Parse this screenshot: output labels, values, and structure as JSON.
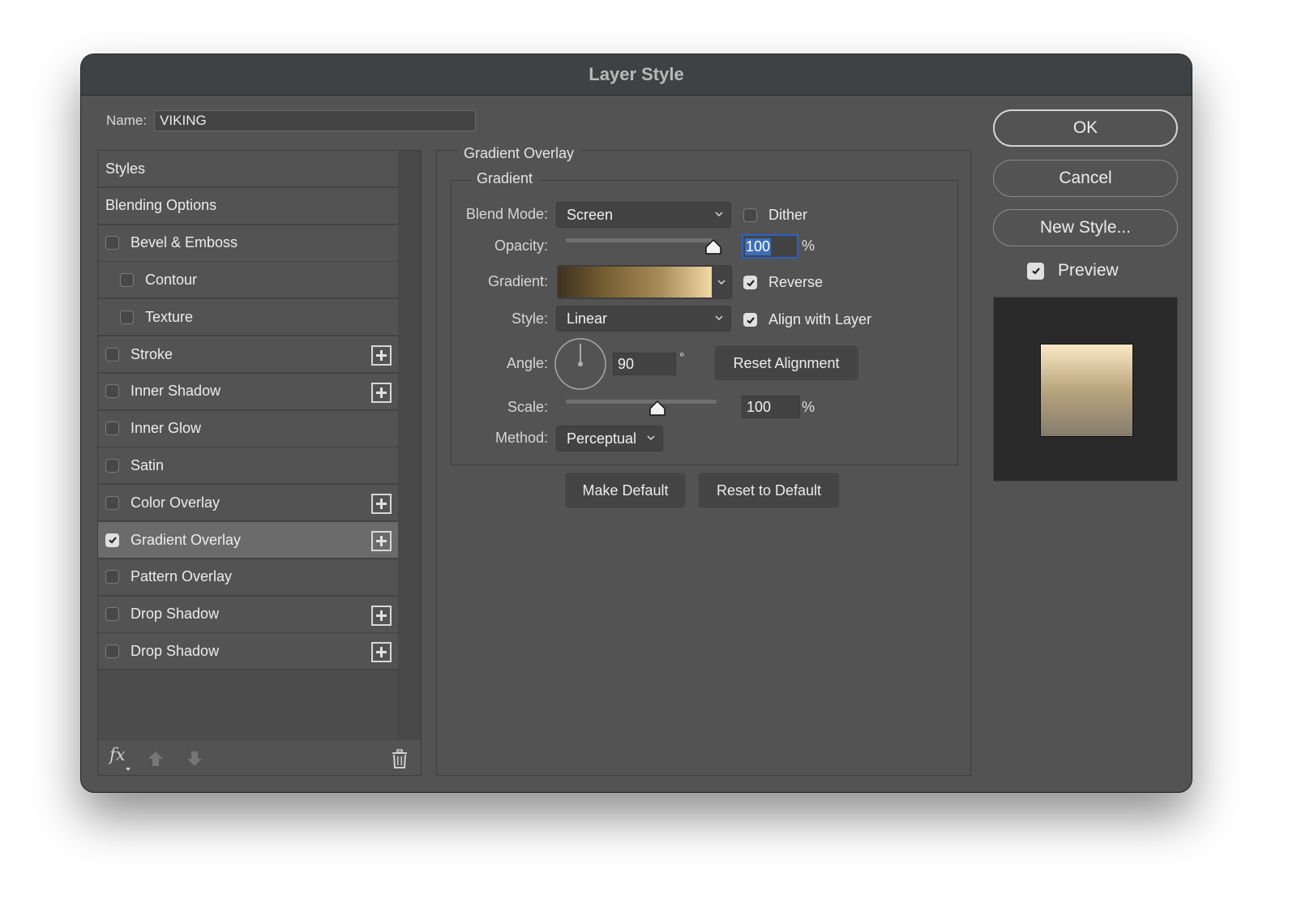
{
  "window": {
    "title": "Layer Style"
  },
  "name_field": {
    "label": "Name:",
    "value": "VIKING"
  },
  "style_list": {
    "items": [
      {
        "label": "Styles",
        "has_checkbox": false,
        "checked": false,
        "indent": false,
        "has_add": false,
        "selected": false
      },
      {
        "label": "Blending Options",
        "has_checkbox": false,
        "checked": false,
        "indent": false,
        "has_add": false,
        "selected": false
      },
      {
        "label": "Bevel & Emboss",
        "has_checkbox": true,
        "checked": false,
        "indent": false,
        "has_add": false,
        "selected": false
      },
      {
        "label": "Contour",
        "has_checkbox": true,
        "checked": false,
        "indent": true,
        "has_add": false,
        "selected": false
      },
      {
        "label": "Texture",
        "has_checkbox": true,
        "checked": false,
        "indent": true,
        "has_add": false,
        "selected": false
      },
      {
        "label": "Stroke",
        "has_checkbox": true,
        "checked": false,
        "indent": false,
        "has_add": true,
        "selected": false
      },
      {
        "label": "Inner Shadow",
        "has_checkbox": true,
        "checked": false,
        "indent": false,
        "has_add": true,
        "selected": false
      },
      {
        "label": "Inner Glow",
        "has_checkbox": true,
        "checked": false,
        "indent": false,
        "has_add": false,
        "selected": false
      },
      {
        "label": "Satin",
        "has_checkbox": true,
        "checked": false,
        "indent": false,
        "has_add": false,
        "selected": false
      },
      {
        "label": "Color Overlay",
        "has_checkbox": true,
        "checked": false,
        "indent": false,
        "has_add": true,
        "selected": false
      },
      {
        "label": "Gradient Overlay",
        "has_checkbox": true,
        "checked": true,
        "indent": false,
        "has_add": true,
        "selected": true
      },
      {
        "label": "Pattern Overlay",
        "has_checkbox": true,
        "checked": false,
        "indent": false,
        "has_add": false,
        "selected": false
      },
      {
        "label": "Drop Shadow",
        "has_checkbox": true,
        "checked": false,
        "indent": false,
        "has_add": true,
        "selected": false
      },
      {
        "label": "Drop Shadow",
        "has_checkbox": true,
        "checked": false,
        "indent": false,
        "has_add": true,
        "selected": false
      }
    ],
    "footer": {
      "fx_label": "fx"
    }
  },
  "gradient_overlay": {
    "section_title": "Gradient Overlay",
    "group_title": "Gradient",
    "blend_mode": {
      "label": "Blend Mode:",
      "value": "Screen"
    },
    "dither": {
      "label": "Dither",
      "checked": false
    },
    "opacity": {
      "label": "Opacity:",
      "value": "100",
      "unit": "%",
      "fraction": 1.0
    },
    "gradient": {
      "label": "Gradient:",
      "colors": [
        "#3e3220",
        "#7a6234",
        "#a88c5a",
        "#f3d8a6"
      ]
    },
    "reverse": {
      "label": "Reverse",
      "checked": true
    },
    "style": {
      "label": "Style:",
      "value": "Linear"
    },
    "align_with_layer": {
      "label": "Align with Layer",
      "checked": true
    },
    "angle": {
      "label": "Angle:",
      "value": "90",
      "unit": "°"
    },
    "reset_alignment": {
      "label": "Reset Alignment"
    },
    "scale": {
      "label": "Scale:",
      "value": "100",
      "unit": "%",
      "fraction": 0.5
    },
    "method": {
      "label": "Method:",
      "value": "Perceptual"
    },
    "make_default": {
      "label": "Make Default"
    },
    "reset_to_default": {
      "label": "Reset to Default"
    }
  },
  "actions": {
    "ok": "OK",
    "cancel": "Cancel",
    "new_style": "New Style...",
    "preview": {
      "label": "Preview",
      "checked": true
    }
  },
  "preview": {
    "top_color": "#fbe8c6",
    "mid_color": "#b8a57e",
    "bottom_color": "#857c6c"
  }
}
